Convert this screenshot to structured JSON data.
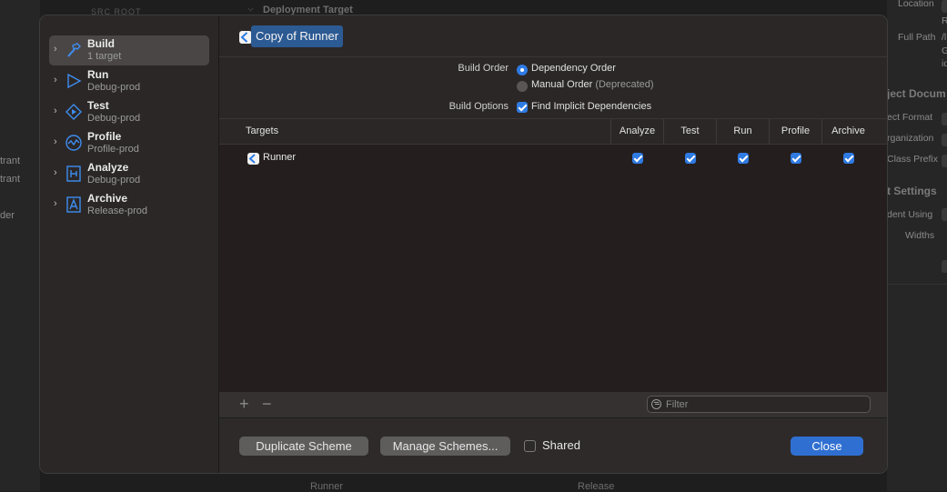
{
  "background": {
    "left_texts": [
      "trant",
      "trant",
      "der"
    ],
    "right_texts": [
      "Location",
      "Full Path",
      "ject Docum",
      "ect Format",
      "rganization",
      "Class Prefix",
      "t Settings",
      "dent Using",
      "Widths"
    ],
    "right_edge_letters": [
      "R",
      "/l",
      "G",
      "id"
    ],
    "top_section": "Deployment Target",
    "top_left_faint": "SRC ROOT",
    "bottom_target": "Runner",
    "bottom_config": "Release"
  },
  "sidebar": {
    "items": [
      {
        "title": "Build",
        "subtitle": "1 target",
        "icon": "hammer-icon",
        "selected": true
      },
      {
        "title": "Run",
        "subtitle": "Debug-prod",
        "icon": "play-icon",
        "selected": false
      },
      {
        "title": "Test",
        "subtitle": "Debug-prod",
        "icon": "test-diamond-icon",
        "selected": false
      },
      {
        "title": "Profile",
        "subtitle": "Profile-prod",
        "icon": "profile-wave-icon",
        "selected": false
      },
      {
        "title": "Analyze",
        "subtitle": "Debug-prod",
        "icon": "analyze-icon",
        "selected": false
      },
      {
        "title": "Archive",
        "subtitle": "Release-prod",
        "icon": "archive-icon",
        "selected": false
      }
    ]
  },
  "header": {
    "scheme_name": "Copy of Runner"
  },
  "build_order": {
    "label": "Build Order",
    "option1": "Dependency Order",
    "option2": "Manual Order",
    "option2_note": "(Deprecated)",
    "selected": "Dependency Order"
  },
  "build_options": {
    "label": "Build Options",
    "find_implicit": "Find Implicit Dependencies",
    "find_implicit_checked": true
  },
  "table": {
    "columns": [
      "Targets",
      "Analyze",
      "Test",
      "Run",
      "Profile",
      "Archive"
    ],
    "rows": [
      {
        "target": "Runner",
        "analyze": true,
        "test": true,
        "run": true,
        "profile": true,
        "archive": true
      }
    ]
  },
  "toolbar": {
    "add": "+",
    "remove": "−",
    "filter_placeholder": "Filter"
  },
  "footer": {
    "duplicate_label": "Duplicate Scheme",
    "manage_label": "Manage Schemes...",
    "shared_label": "Shared",
    "shared_checked": false,
    "close_label": "Close"
  },
  "colors": {
    "accent": "#2f7be4",
    "selection": "#2c5a93",
    "close_button": "#2f6fd1"
  }
}
